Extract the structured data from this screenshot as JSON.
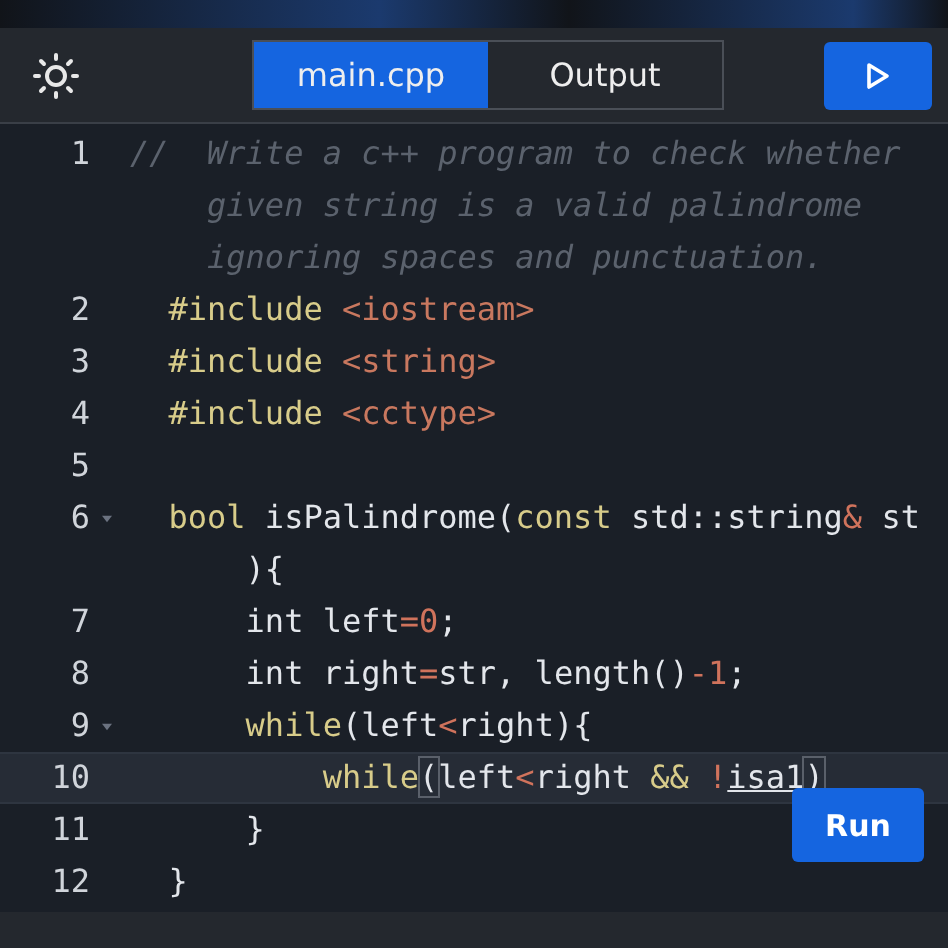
{
  "toolbar": {
    "tabs": [
      {
        "label": "main.cpp",
        "selected": true
      },
      {
        "label": "Output",
        "selected": false
      }
    ]
  },
  "editor": {
    "lines": [
      {
        "number": "1",
        "foldable": false,
        "active": false,
        "rows": [
          [
            {
              "kind": "comment",
              "text": "//  Write a c++ program to check whether"
            }
          ],
          [
            {
              "kind": "comment",
              "text": "    given string is a valid palindrome"
            }
          ],
          [
            {
              "kind": "comment",
              "text": "    ignoring spaces and punctuation."
            }
          ]
        ]
      },
      {
        "number": "2",
        "foldable": false,
        "active": false,
        "rows": [
          [
            {
              "kind": "keyword",
              "text": "  #include "
            },
            {
              "kind": "string",
              "text": "<iostream>"
            }
          ]
        ]
      },
      {
        "number": "3",
        "foldable": false,
        "active": false,
        "rows": [
          [
            {
              "kind": "keyword",
              "text": "  #include "
            },
            {
              "kind": "string",
              "text": "<string>"
            }
          ]
        ]
      },
      {
        "number": "4",
        "foldable": false,
        "active": false,
        "rows": [
          [
            {
              "kind": "keyword",
              "text": "  #include "
            },
            {
              "kind": "string",
              "text": "<cctype>"
            }
          ]
        ]
      },
      {
        "number": "5",
        "foldable": false,
        "active": false,
        "rows": [
          []
        ]
      },
      {
        "number": "6",
        "foldable": true,
        "active": false,
        "rows": [
          [
            {
              "kind": "keyword",
              "text": "  bool"
            },
            {
              "kind": "plain",
              "text": " isPalindrome("
            },
            {
              "kind": "keyword",
              "text": "const"
            },
            {
              "kind": "plain",
              "text": " std::string"
            },
            {
              "kind": "operator",
              "text": "&"
            },
            {
              "kind": "plain",
              "text": " st"
            }
          ],
          [
            {
              "kind": "plain",
              "text": "      ){"
            }
          ]
        ]
      },
      {
        "number": "7",
        "foldable": false,
        "active": false,
        "rows": [
          [
            {
              "kind": "plain",
              "text": "      int left"
            },
            {
              "kind": "operator",
              "text": "="
            },
            {
              "kind": "number",
              "text": "0"
            },
            {
              "kind": "plain",
              "text": ";"
            }
          ]
        ]
      },
      {
        "number": "8",
        "foldable": false,
        "active": false,
        "rows": [
          [
            {
              "kind": "plain",
              "text": "      int right"
            },
            {
              "kind": "operator",
              "text": "="
            },
            {
              "kind": "plain",
              "text": "str, length()"
            },
            {
              "kind": "operator",
              "text": "-"
            },
            {
              "kind": "number",
              "text": "1"
            },
            {
              "kind": "plain",
              "text": ";"
            }
          ]
        ]
      },
      {
        "number": "9",
        "foldable": true,
        "active": false,
        "rows": [
          [
            {
              "kind": "keyword",
              "text": "      while"
            },
            {
              "kind": "plain",
              "text": "(left"
            },
            {
              "kind": "operator",
              "text": "<"
            },
            {
              "kind": "plain",
              "text": "right){"
            }
          ]
        ]
      },
      {
        "number": "10",
        "foldable": false,
        "active": true,
        "rows": [
          [
            {
              "kind": "keyword",
              "text": "          while"
            },
            {
              "kind": "bracket",
              "text": "("
            },
            {
              "kind": "plain",
              "text": "left"
            },
            {
              "kind": "operator",
              "text": "<"
            },
            {
              "kind": "plain",
              "text": "right "
            },
            {
              "kind": "keyword",
              "text": "&&"
            },
            {
              "kind": "plain",
              "text": " "
            },
            {
              "kind": "operator",
              "text": "!"
            },
            {
              "kind": "underlined",
              "text": "isa1"
            },
            {
              "kind": "bracket",
              "text": ")"
            }
          ]
        ]
      },
      {
        "number": "11",
        "foldable": false,
        "active": false,
        "rows": [
          [
            {
              "kind": "plain",
              "text": "      }"
            }
          ]
        ]
      },
      {
        "number": "12",
        "foldable": false,
        "active": false,
        "rows": [
          [
            {
              "kind": "plain",
              "text": "  }"
            }
          ]
        ]
      }
    ]
  },
  "run_button": {
    "label": "Run"
  }
}
